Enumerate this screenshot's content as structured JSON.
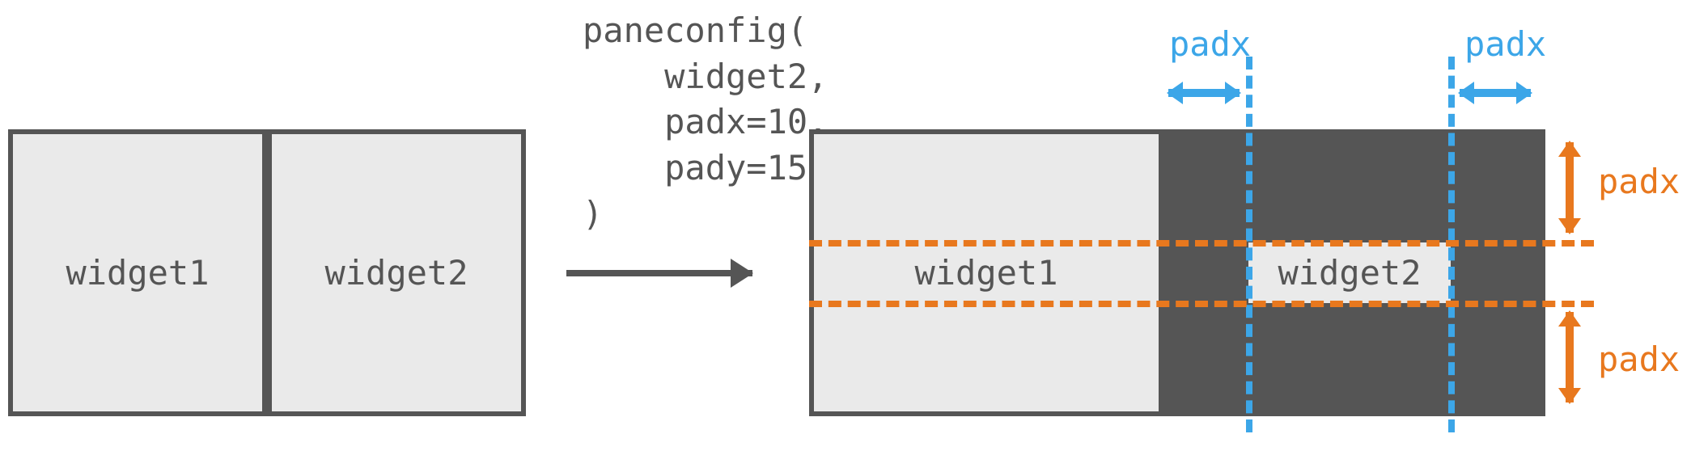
{
  "left_panel": {
    "widget1": "widget1",
    "widget2": "widget2"
  },
  "code": {
    "text": "paneconfig(\n    widget2,\n    padx=10,\n    pady=15\n)"
  },
  "right_panel": {
    "widget1": "widget1",
    "widget2": "widget2"
  },
  "labels": {
    "padx_top_left": "padx",
    "padx_top_right": "padx",
    "padx_right_top": "padx",
    "padx_right_bottom": "padx"
  }
}
